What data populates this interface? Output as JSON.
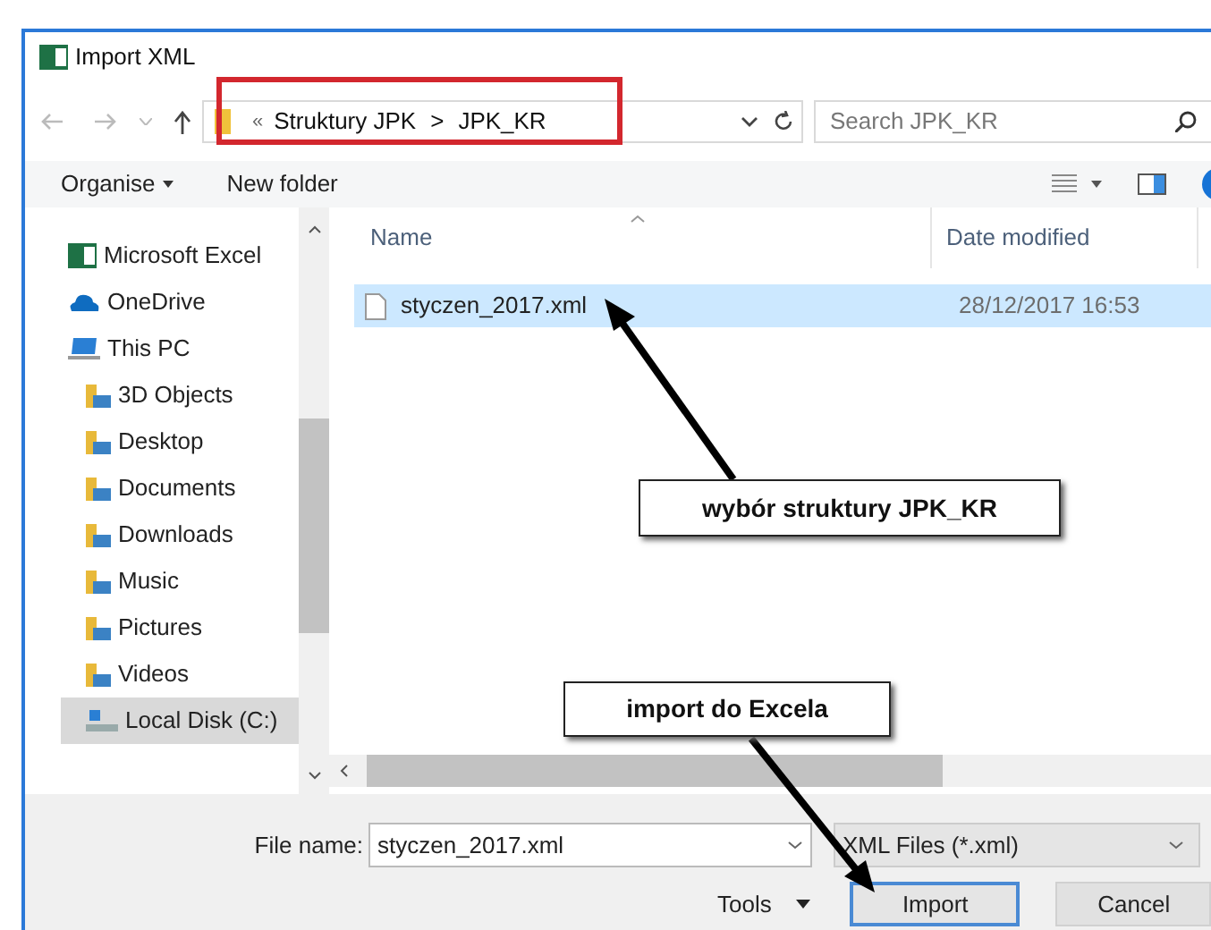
{
  "window": {
    "title": "Import XML"
  },
  "address": {
    "overflow": "«",
    "crumbs": [
      "Struktury JPK",
      "JPK_KR"
    ],
    "separator": ">"
  },
  "search": {
    "placeholder": "Search JPK_KR"
  },
  "toolbar": {
    "organise": "Organise",
    "new_folder": "New folder"
  },
  "sidebar": {
    "items": [
      {
        "label": "Microsoft Excel",
        "kind": "excel",
        "selected": false
      },
      {
        "label": "OneDrive",
        "kind": "cloud",
        "selected": false
      },
      {
        "label": "This PC",
        "kind": "pc",
        "selected": false,
        "children": [
          {
            "label": "3D Objects",
            "kind": "folder",
            "selected": false
          },
          {
            "label": "Desktop",
            "kind": "folder",
            "selected": false
          },
          {
            "label": "Documents",
            "kind": "folder",
            "selected": false
          },
          {
            "label": "Downloads",
            "kind": "folder",
            "selected": false
          },
          {
            "label": "Music",
            "kind": "folder",
            "selected": false
          },
          {
            "label": "Pictures",
            "kind": "folder",
            "selected": false
          },
          {
            "label": "Videos",
            "kind": "folder",
            "selected": false
          },
          {
            "label": "Local Disk (C:)",
            "kind": "disk",
            "selected": true
          }
        ]
      }
    ]
  },
  "table": {
    "columns": [
      "Name",
      "Date modified"
    ],
    "rows": [
      {
        "name": "styczen_2017.xml",
        "date": "28/12/2017 16:53",
        "selected": true
      }
    ]
  },
  "footer": {
    "file_name_label": "File name:",
    "file_name": "styczen_2017.xml",
    "filter": "XML Files (*.xml)",
    "tools": "Tools",
    "import": "Import",
    "cancel": "Cancel"
  },
  "annotations": [
    {
      "text": "wybór struktury JPK_KR"
    },
    {
      "text": "import do Excela"
    }
  ]
}
